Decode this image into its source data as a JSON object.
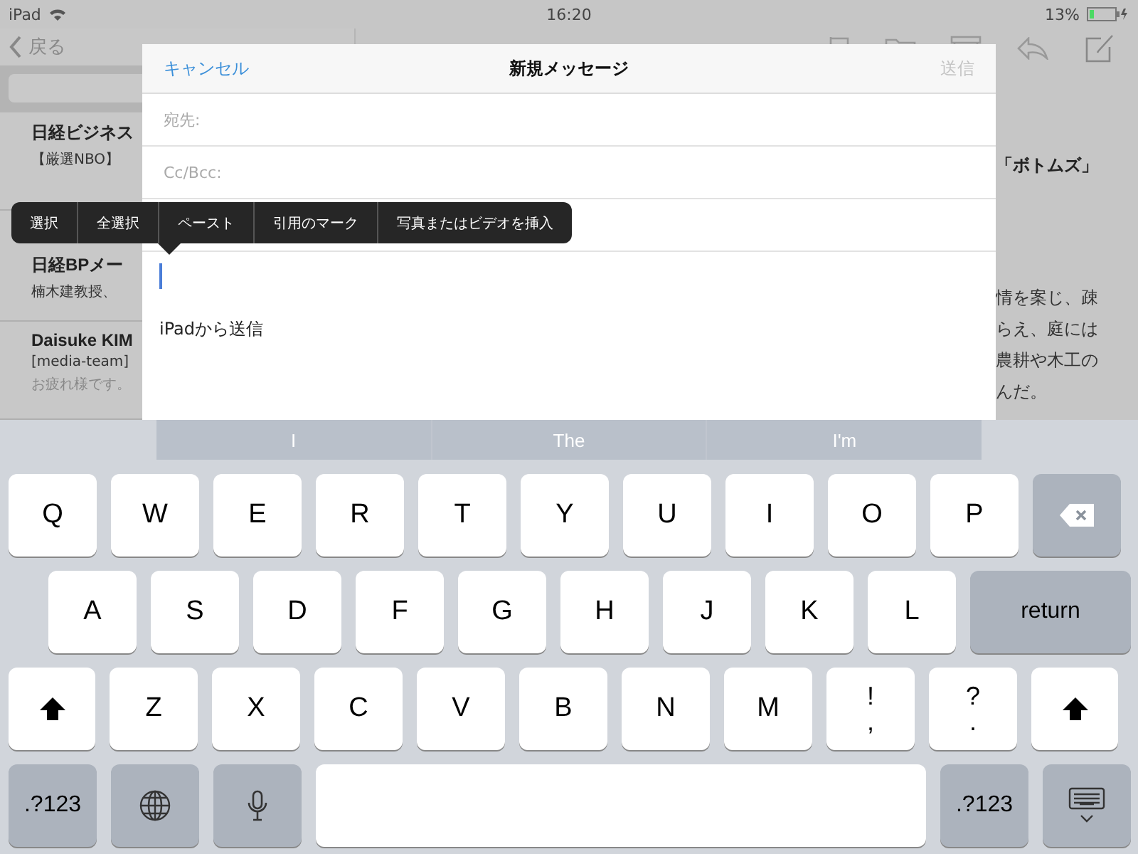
{
  "status_bar": {
    "device": "iPad",
    "time": "16:20",
    "battery": "13%"
  },
  "sidebar": {
    "back": "戻る",
    "items": [
      {
        "sender": "日経ビジネス",
        "subject": "【厳選NBO】"
      },
      {
        "sender": "日経BPメー",
        "subject": "楠木建教授、"
      },
      {
        "sender": "Daisuke KIM",
        "subject": "[media-team]",
        "preview": "お疲れ様です。"
      }
    ]
  },
  "reader": {
    "heading": "「ボトムズ」",
    "lines": [
      "情を案じ、疎",
      "らえ、庭には",
      "農耕や木工の",
      "んだ。"
    ]
  },
  "compose": {
    "cancel": "キャンセル",
    "title": "新規メッセージ",
    "send": "送信",
    "send_disabled": true,
    "fields": [
      {
        "label": "宛先:"
      },
      {
        "label": "Cc/Bcc:"
      }
    ],
    "signature": "iPadから送信"
  },
  "edit_menu": [
    "選択",
    "全選択",
    "ペースト",
    "引用のマーク",
    "写真またはビデオを挿入"
  ],
  "keyboard": {
    "suggestions": [
      "I",
      "The",
      "I'm"
    ],
    "rows": [
      {
        "keys": [
          {
            "kind": "letter",
            "label": "Q"
          },
          {
            "kind": "letter",
            "label": "W"
          },
          {
            "kind": "letter",
            "label": "E"
          },
          {
            "kind": "letter",
            "label": "R"
          },
          {
            "kind": "letter",
            "label": "T"
          },
          {
            "kind": "letter",
            "label": "Y"
          },
          {
            "kind": "letter",
            "label": "U"
          },
          {
            "kind": "letter",
            "label": "I"
          },
          {
            "kind": "letter",
            "label": "O"
          },
          {
            "kind": "letter",
            "label": "P"
          },
          {
            "kind": "delete"
          }
        ]
      },
      {
        "keys": [
          {
            "kind": "letter",
            "label": "A"
          },
          {
            "kind": "letter",
            "label": "S"
          },
          {
            "kind": "letter",
            "label": "D"
          },
          {
            "kind": "letter",
            "label": "F"
          },
          {
            "kind": "letter",
            "label": "G"
          },
          {
            "kind": "letter",
            "label": "H"
          },
          {
            "kind": "letter",
            "label": "J"
          },
          {
            "kind": "letter",
            "label": "K"
          },
          {
            "kind": "letter",
            "label": "L"
          },
          {
            "kind": "return",
            "label": "return"
          }
        ]
      },
      {
        "keys": [
          {
            "kind": "shift"
          },
          {
            "kind": "letter",
            "label": "Z"
          },
          {
            "kind": "letter",
            "label": "X"
          },
          {
            "kind": "letter",
            "label": "C"
          },
          {
            "kind": "letter",
            "label": "V"
          },
          {
            "kind": "letter",
            "label": "B"
          },
          {
            "kind": "letter",
            "label": "N"
          },
          {
            "kind": "letter",
            "label": "M"
          },
          {
            "kind": "dual",
            "top": "!",
            "bottom": ","
          },
          {
            "kind": "dual",
            "top": "?",
            "bottom": "."
          },
          {
            "kind": "shift"
          }
        ]
      },
      {
        "keys": [
          {
            "kind": "numbers",
            "label": ".?123"
          },
          {
            "kind": "globe"
          },
          {
            "kind": "mic"
          },
          {
            "kind": "space"
          },
          {
            "kind": "numbers",
            "label": ".?123"
          },
          {
            "kind": "hide"
          }
        ]
      }
    ]
  }
}
